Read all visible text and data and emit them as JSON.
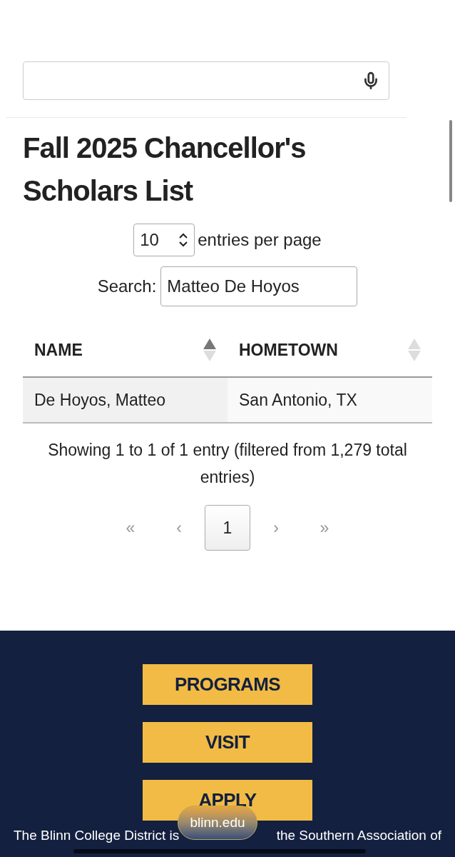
{
  "title": "Fall 2025 Chancellor's Scholars List",
  "length_menu": {
    "value": "10",
    "label": "entries per page"
  },
  "search": {
    "label": "Search:",
    "value": "Matteo De Hoyos"
  },
  "table": {
    "columns": [
      {
        "label": "NAME",
        "sorted_ascending": true
      },
      {
        "label": "HOMETOWN",
        "sorted_ascending": false
      }
    ],
    "rows": [
      [
        "De Hoyos, Matteo",
        "San Antonio, TX"
      ]
    ]
  },
  "info": "Showing 1 to 1 of 1 entry (filtered from 1,279 total entries)",
  "pagination": [
    {
      "label": "«",
      "selected": false,
      "disabled": true
    },
    {
      "label": "‹",
      "selected": false,
      "disabled": true
    },
    {
      "label": "1",
      "selected": true,
      "disabled": false
    },
    {
      "label": "›",
      "selected": false,
      "disabled": true
    },
    {
      "label": "»",
      "selected": false,
      "disabled": true
    }
  ],
  "footer": {
    "buttons": [
      "PROGRAMS",
      "VISIT",
      "APPLY"
    ],
    "text_start": "The Blinn College District is",
    "text_end": "the Southern Association of"
  },
  "url_pill": "blinn.edu"
}
